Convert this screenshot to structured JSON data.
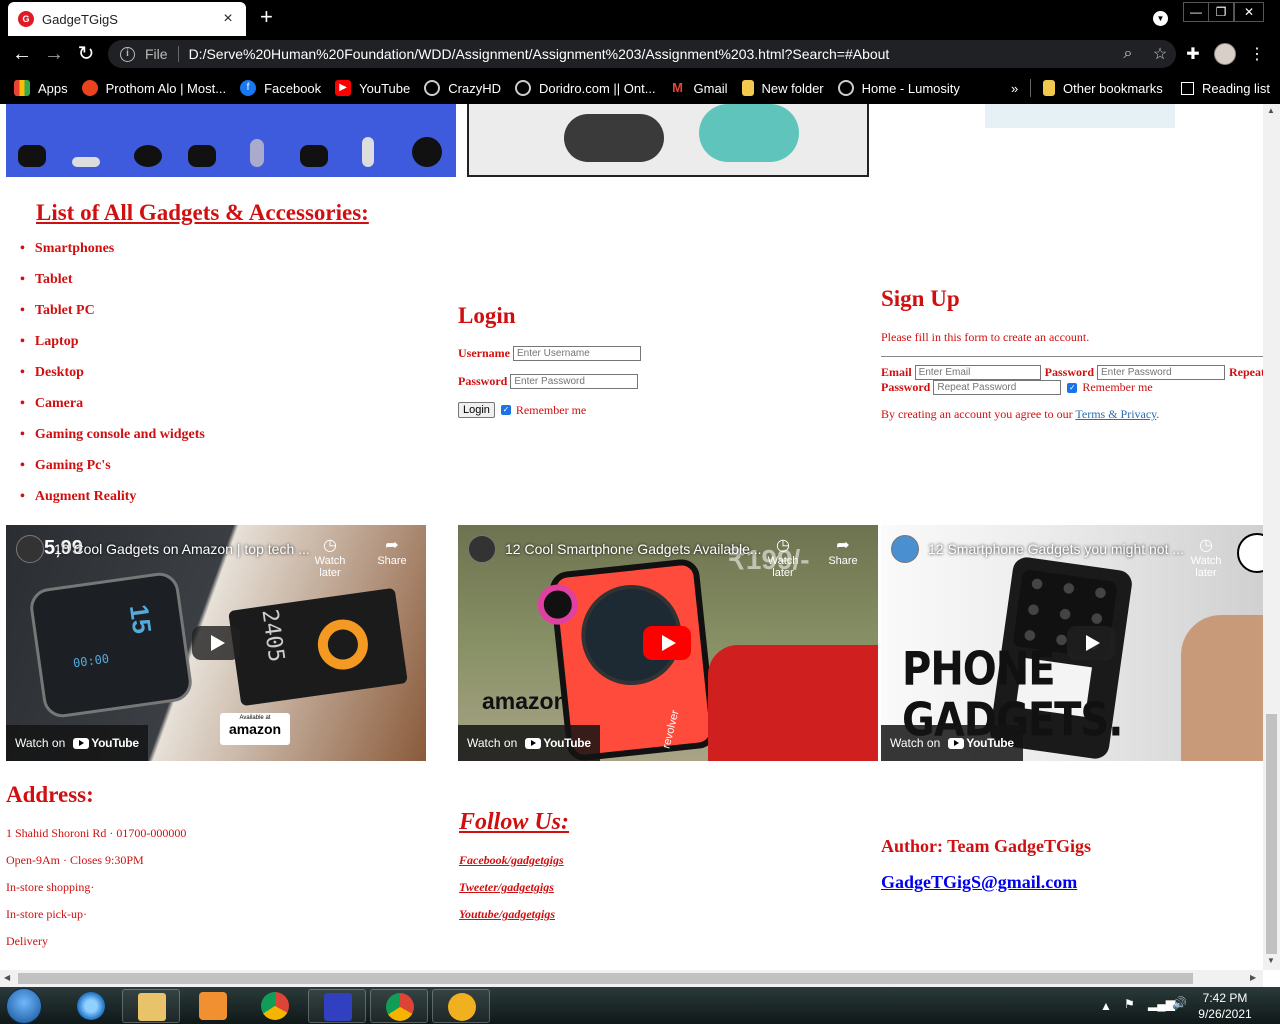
{
  "browser": {
    "tab_title": "GadgeTGigS",
    "tab_favicon_text": "G",
    "tab_close": "×",
    "new_tab": "+",
    "back": "←",
    "forward": "→",
    "reload": "↻",
    "file_label": "File",
    "url": "D:/Serve%20Human%20Foundation/WDD/Assignment/Assignment%203/Assignment%203.html?Search=#About",
    "minimize": "—",
    "restore": "❐",
    "close": "✕"
  },
  "bookmarks": [
    {
      "label": "Apps",
      "icon": "apps-grid-icon",
      "color": "#4285f4"
    },
    {
      "label": "Prothom Alo | Most...",
      "icon": "prothom-alo-icon",
      "color": "#e8431c"
    },
    {
      "label": "Facebook",
      "icon": "facebook-icon",
      "color": "#1877f2"
    },
    {
      "label": "YouTube",
      "icon": "youtube-icon",
      "color": "#ff0000"
    },
    {
      "label": "CrazyHD",
      "icon": "globe-icon",
      "color": "#555555"
    },
    {
      "label": "Doridro.com || Ont...",
      "icon": "globe-icon",
      "color": "#555555"
    },
    {
      "label": "Gmail",
      "icon": "gmail-icon",
      "color": "#ea4335"
    },
    {
      "label": "New folder",
      "icon": "folder-icon",
      "color": "#f2c94c"
    },
    {
      "label": "Home - Lumosity",
      "icon": "globe-icon",
      "color": "#555555"
    }
  ],
  "bookmarks_overflow": "»",
  "other_bookmarks": "Other bookmarks",
  "reading_list": "Reading list",
  "page": {
    "list_title": "List of All Gadgets & Accessories:",
    "gadgets": [
      "Smartphones",
      "Tablet",
      "Tablet PC",
      "Laptop",
      "Desktop",
      "Camera",
      "Gaming console and widgets",
      "Gaming Pc's",
      "Augment Reality"
    ],
    "login": {
      "title": "Login",
      "username_label": "Username",
      "username_placeholder": "Enter Username",
      "password_label": "Password",
      "password_placeholder": "Enter Password",
      "button": "Login",
      "remember": "Remember me"
    },
    "signup": {
      "title": "Sign Up",
      "subtitle": "Please fill in this form to create an account.",
      "email_label": "Email",
      "email_placeholder": "Enter Email",
      "password_label": "Password",
      "password_placeholder": "Enter Password",
      "repeat_label_1": "Repeat",
      "repeat_label_2": "Password",
      "repeat_placeholder": "Repeat Password",
      "remember": "Remember me",
      "terms_prefix": "By creating an account you agree to our ",
      "terms_link": "Terms & Privacy",
      "terms_suffix": "."
    },
    "videos": [
      {
        "title": "10 Cool Gadgets on Amazon | top tech ...",
        "watch_later": "Watch later",
        "share": "Share",
        "watch_on": "Watch on",
        "youtube": "YouTube",
        "overlay": "5,99",
        "badge_small": "Available at",
        "badge_big": "amazon",
        "device_text": "2405"
      },
      {
        "title": "12 Cool Smartphone Gadgets Available...",
        "watch_later": "Watch later",
        "share": "Share",
        "watch_on": "Watch on",
        "youtube": "YouTube",
        "overlay": "₹199/-",
        "badge_big": "amazon",
        "device_text": "revolver"
      },
      {
        "title": "12 Smartphone Gadgets you might not ...",
        "watch_later": "Watch later",
        "watch_on": "Watch on",
        "youtube": "YouTube",
        "overlay_line1": "PHONE",
        "overlay_line2": "GADGETS."
      }
    ],
    "address": {
      "title": "Address:",
      "lines": [
        "1 Shahid Shoroni Rd · 01700-000000",
        "Open-9Am · Closes 9:30PM",
        "In-store shopping·",
        "In-store pick-up·",
        "Delivery"
      ]
    },
    "follow": {
      "title": "Follow Us:",
      "links": [
        "Facebook/gadgetgigs",
        "Tweeter/gadgetgigs",
        "Youtube/gadgetgigs"
      ]
    },
    "author": {
      "label": "Author: Team GadgeTGigs",
      "email": "GadgeTGigS@gmail.com"
    }
  },
  "taskbar": {
    "time": "7:42 PM",
    "date": "9/26/2021"
  },
  "colors": {
    "accent_red": "#d01010",
    "link_blue": "#2b6cb0",
    "email_blue": "#0000ee"
  }
}
